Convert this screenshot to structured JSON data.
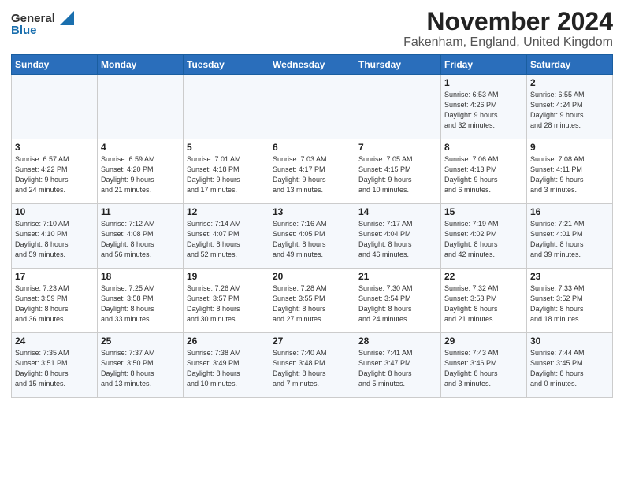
{
  "header": {
    "logo_general": "General",
    "logo_blue": "Blue",
    "title": "November 2024",
    "subtitle": "Fakenham, England, United Kingdom"
  },
  "weekdays": [
    "Sunday",
    "Monday",
    "Tuesday",
    "Wednesday",
    "Thursday",
    "Friday",
    "Saturday"
  ],
  "weeks": [
    [
      {
        "day": "",
        "info": ""
      },
      {
        "day": "",
        "info": ""
      },
      {
        "day": "",
        "info": ""
      },
      {
        "day": "",
        "info": ""
      },
      {
        "day": "",
        "info": ""
      },
      {
        "day": "1",
        "info": "Sunrise: 6:53 AM\nSunset: 4:26 PM\nDaylight: 9 hours\nand 32 minutes."
      },
      {
        "day": "2",
        "info": "Sunrise: 6:55 AM\nSunset: 4:24 PM\nDaylight: 9 hours\nand 28 minutes."
      }
    ],
    [
      {
        "day": "3",
        "info": "Sunrise: 6:57 AM\nSunset: 4:22 PM\nDaylight: 9 hours\nand 24 minutes."
      },
      {
        "day": "4",
        "info": "Sunrise: 6:59 AM\nSunset: 4:20 PM\nDaylight: 9 hours\nand 21 minutes."
      },
      {
        "day": "5",
        "info": "Sunrise: 7:01 AM\nSunset: 4:18 PM\nDaylight: 9 hours\nand 17 minutes."
      },
      {
        "day": "6",
        "info": "Sunrise: 7:03 AM\nSunset: 4:17 PM\nDaylight: 9 hours\nand 13 minutes."
      },
      {
        "day": "7",
        "info": "Sunrise: 7:05 AM\nSunset: 4:15 PM\nDaylight: 9 hours\nand 10 minutes."
      },
      {
        "day": "8",
        "info": "Sunrise: 7:06 AM\nSunset: 4:13 PM\nDaylight: 9 hours\nand 6 minutes."
      },
      {
        "day": "9",
        "info": "Sunrise: 7:08 AM\nSunset: 4:11 PM\nDaylight: 9 hours\nand 3 minutes."
      }
    ],
    [
      {
        "day": "10",
        "info": "Sunrise: 7:10 AM\nSunset: 4:10 PM\nDaylight: 8 hours\nand 59 minutes."
      },
      {
        "day": "11",
        "info": "Sunrise: 7:12 AM\nSunset: 4:08 PM\nDaylight: 8 hours\nand 56 minutes."
      },
      {
        "day": "12",
        "info": "Sunrise: 7:14 AM\nSunset: 4:07 PM\nDaylight: 8 hours\nand 52 minutes."
      },
      {
        "day": "13",
        "info": "Sunrise: 7:16 AM\nSunset: 4:05 PM\nDaylight: 8 hours\nand 49 minutes."
      },
      {
        "day": "14",
        "info": "Sunrise: 7:17 AM\nSunset: 4:04 PM\nDaylight: 8 hours\nand 46 minutes."
      },
      {
        "day": "15",
        "info": "Sunrise: 7:19 AM\nSunset: 4:02 PM\nDaylight: 8 hours\nand 42 minutes."
      },
      {
        "day": "16",
        "info": "Sunrise: 7:21 AM\nSunset: 4:01 PM\nDaylight: 8 hours\nand 39 minutes."
      }
    ],
    [
      {
        "day": "17",
        "info": "Sunrise: 7:23 AM\nSunset: 3:59 PM\nDaylight: 8 hours\nand 36 minutes."
      },
      {
        "day": "18",
        "info": "Sunrise: 7:25 AM\nSunset: 3:58 PM\nDaylight: 8 hours\nand 33 minutes."
      },
      {
        "day": "19",
        "info": "Sunrise: 7:26 AM\nSunset: 3:57 PM\nDaylight: 8 hours\nand 30 minutes."
      },
      {
        "day": "20",
        "info": "Sunrise: 7:28 AM\nSunset: 3:55 PM\nDaylight: 8 hours\nand 27 minutes."
      },
      {
        "day": "21",
        "info": "Sunrise: 7:30 AM\nSunset: 3:54 PM\nDaylight: 8 hours\nand 24 minutes."
      },
      {
        "day": "22",
        "info": "Sunrise: 7:32 AM\nSunset: 3:53 PM\nDaylight: 8 hours\nand 21 minutes."
      },
      {
        "day": "23",
        "info": "Sunrise: 7:33 AM\nSunset: 3:52 PM\nDaylight: 8 hours\nand 18 minutes."
      }
    ],
    [
      {
        "day": "24",
        "info": "Sunrise: 7:35 AM\nSunset: 3:51 PM\nDaylight: 8 hours\nand 15 minutes."
      },
      {
        "day": "25",
        "info": "Sunrise: 7:37 AM\nSunset: 3:50 PM\nDaylight: 8 hours\nand 13 minutes."
      },
      {
        "day": "26",
        "info": "Sunrise: 7:38 AM\nSunset: 3:49 PM\nDaylight: 8 hours\nand 10 minutes."
      },
      {
        "day": "27",
        "info": "Sunrise: 7:40 AM\nSunset: 3:48 PM\nDaylight: 8 hours\nand 7 minutes."
      },
      {
        "day": "28",
        "info": "Sunrise: 7:41 AM\nSunset: 3:47 PM\nDaylight: 8 hours\nand 5 minutes."
      },
      {
        "day": "29",
        "info": "Sunrise: 7:43 AM\nSunset: 3:46 PM\nDaylight: 8 hours\nand 3 minutes."
      },
      {
        "day": "30",
        "info": "Sunrise: 7:44 AM\nSunset: 3:45 PM\nDaylight: 8 hours\nand 0 minutes."
      }
    ]
  ]
}
